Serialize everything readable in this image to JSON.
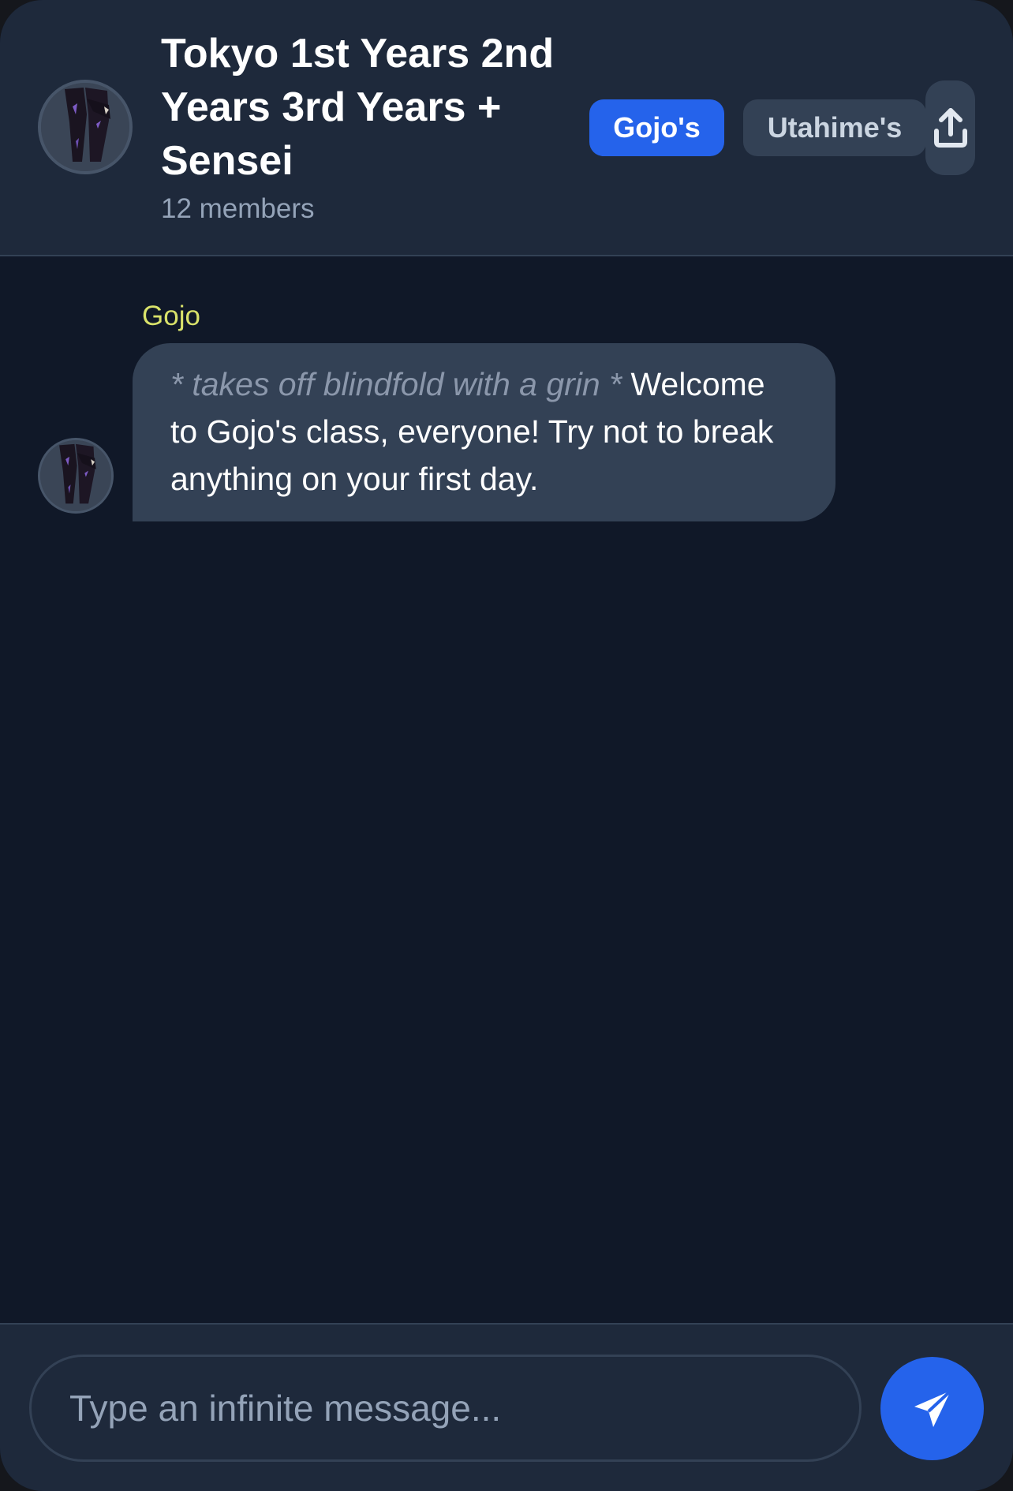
{
  "header": {
    "title": "Tokyo 1st Years 2nd Years 3rd Years + Sensei",
    "members": "12 members",
    "class_buttons": [
      "Gojo's",
      "Utahime's"
    ],
    "active_class": "Gojo's",
    "share_icon": "upload-icon"
  },
  "messages": [
    {
      "sender": "Gojo",
      "action": "* takes off blindfold with a grin *",
      "text": "Welcome to Gojo's class, everyone! Try not to break anything on your first day."
    }
  ],
  "composer": {
    "placeholder": "Type an infinite message...",
    "send_icon": "send-icon"
  },
  "colors": {
    "header_bg": "#1e293b",
    "chat_bg": "#101828",
    "accent": "#2563eb",
    "bubble_bg": "#334155",
    "sender_name": "#d9e26a"
  }
}
